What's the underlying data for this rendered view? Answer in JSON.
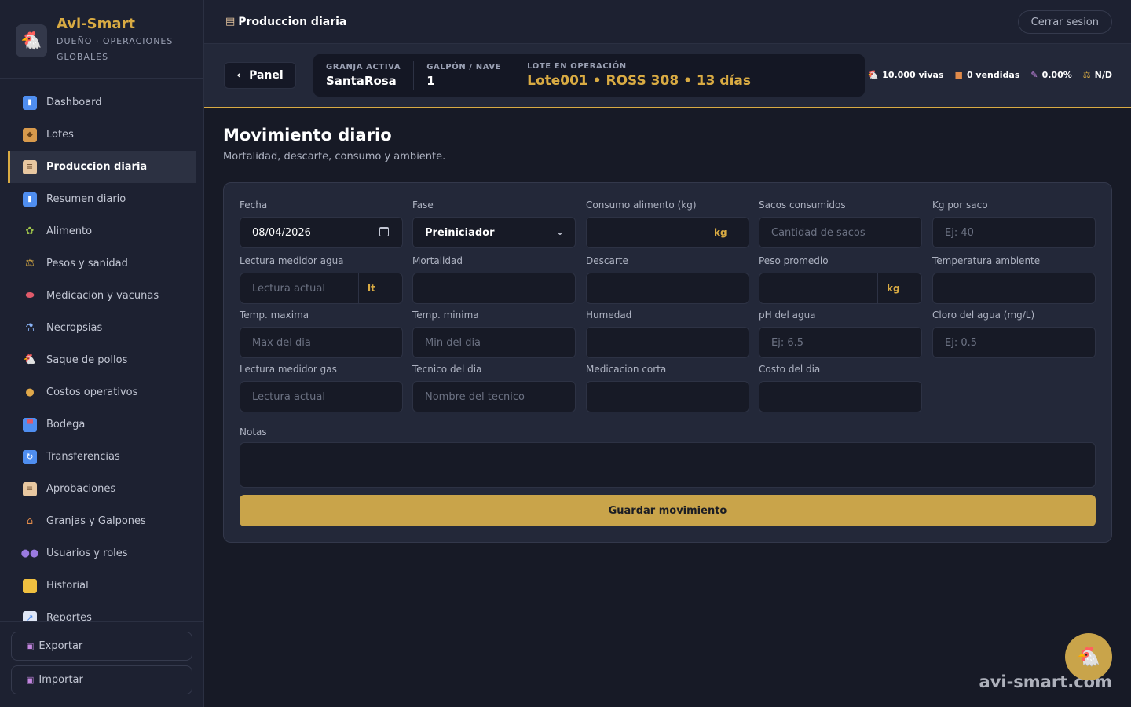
{
  "brand": {
    "title": "Avi-Smart",
    "subtitle": "DUEÑO · OPERACIONES GLOBALES",
    "logo_icon": "hen-icon"
  },
  "sidebar": {
    "items": [
      {
        "label": "Dashboard",
        "icon": "bar-chart-icon",
        "color": "#4f8ef0"
      },
      {
        "label": "Lotes",
        "icon": "package-icon",
        "color": "#d89a4c"
      },
      {
        "label": "Produccion diaria",
        "icon": "clipboard-icon",
        "color": "#e8c7a0",
        "active": true
      },
      {
        "label": "Resumen diario",
        "icon": "bar-chart-icon",
        "color": "#4f8ef0"
      },
      {
        "label": "Alimento",
        "icon": "grain-icon",
        "color": "#9ec34a"
      },
      {
        "label": "Pesos y sanidad",
        "icon": "scale-icon",
        "color": "#d9ab43"
      },
      {
        "label": "Medicacion y vacunas",
        "icon": "pill-icon",
        "color": "#e05a6a"
      },
      {
        "label": "Necropsias",
        "icon": "microscope-icon",
        "color": "#8ab4f8"
      },
      {
        "label": "Saque de pollos",
        "icon": "hen-icon",
        "color": "#ffffff"
      },
      {
        "label": "Costos operativos",
        "icon": "money-bag-icon",
        "color": "#e0a84a"
      },
      {
        "label": "Bodega",
        "icon": "store-icon",
        "color": "#e05a6a"
      },
      {
        "label": "Transferencias",
        "icon": "refresh-icon",
        "color": "#4f8ef0"
      },
      {
        "label": "Aprobaciones",
        "icon": "clipboard-icon",
        "color": "#e8c7a0"
      },
      {
        "label": "Granjas y Galpones",
        "icon": "house-icon",
        "color": "#e08a4a"
      },
      {
        "label": "Usuarios y roles",
        "icon": "users-icon",
        "color": "#9a7ae0"
      },
      {
        "label": "Historial",
        "icon": "folder-icon",
        "color": "#f0c040"
      },
      {
        "label": "Reportes",
        "icon": "line-chart-icon",
        "color": "#8ab4f8"
      }
    ],
    "export_label": "Exportar",
    "import_label": "Importar"
  },
  "topbar": {
    "title": "Produccion diaria",
    "logout_label": "Cerrar sesion"
  },
  "context": {
    "panel_label": "Panel",
    "farm_label": "GRANJA ACTIVA",
    "farm_value": "SantaRosa",
    "barn_label": "GALPÓN / NAVE",
    "barn_value": "1",
    "lot_label": "LOTE EN OPERACIÓN",
    "lot_value": "Lote001 • ROSS 308 • 13 días",
    "stats": {
      "alive": "10.000 vivas",
      "sold": "0 vendidas",
      "mortality": "0.00%",
      "weight": "N/D"
    }
  },
  "page": {
    "title": "Movimiento diario",
    "subtitle": "Mortalidad, descarte, consumo y ambiente."
  },
  "form": {
    "fecha": {
      "label": "Fecha",
      "value": "08/04/2026"
    },
    "fase": {
      "label": "Fase",
      "value": "Preiniciador"
    },
    "consumo": {
      "label": "Consumo alimento (kg)",
      "suffix": "kg"
    },
    "sacos": {
      "label": "Sacos consumidos",
      "placeholder": "Cantidad de sacos"
    },
    "kg_saco": {
      "label": "Kg por saco",
      "placeholder": "Ej: 40"
    },
    "agua": {
      "label": "Lectura medidor agua",
      "placeholder": "Lectura actual",
      "suffix": "lt"
    },
    "mortalidad": {
      "label": "Mortalidad"
    },
    "descarte": {
      "label": "Descarte"
    },
    "peso": {
      "label": "Peso promedio",
      "suffix": "kg"
    },
    "temp_amb": {
      "label": "Temperatura ambiente"
    },
    "temp_max": {
      "label": "Temp. maxima",
      "placeholder": "Max del dia"
    },
    "temp_min": {
      "label": "Temp. minima",
      "placeholder": "Min del dia"
    },
    "humedad": {
      "label": "Humedad"
    },
    "ph": {
      "label": "pH del agua",
      "placeholder": "Ej: 6.5"
    },
    "cloro": {
      "label": "Cloro del agua (mg/L)",
      "placeholder": "Ej: 0.5"
    },
    "gas": {
      "label": "Lectura medidor gas",
      "placeholder": "Lectura actual"
    },
    "tecnico": {
      "label": "Tecnico del dia",
      "placeholder": "Nombre del tecnico"
    },
    "medicacion": {
      "label": "Medicacion corta"
    },
    "costo": {
      "label": "Costo del dia"
    },
    "notas": {
      "label": "Notas"
    },
    "save_label": "Guardar movimiento"
  },
  "watermark": "avi-smart.com",
  "colors": {
    "accent": "#d9ab43",
    "button": "#c9a44a",
    "bg": "#171a26",
    "sidebar": "#1d2131"
  }
}
